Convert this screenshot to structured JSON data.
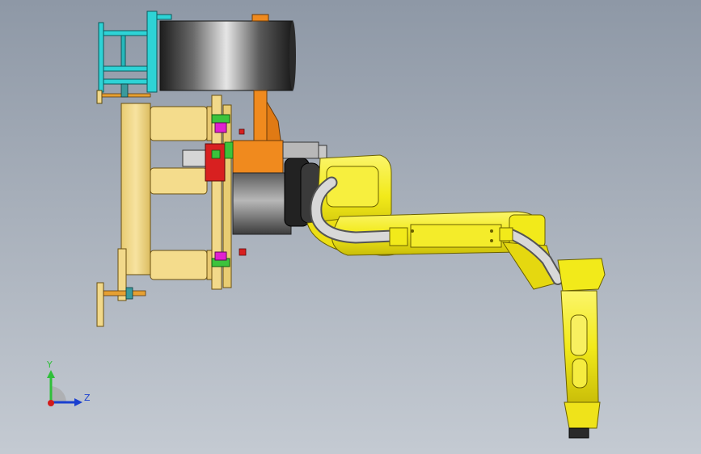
{
  "triad": {
    "y_label": "Y",
    "z_label": "Z",
    "y_color": "#2fbf3a",
    "z_color": "#1a3fd0",
    "x_color": "#d21b1b"
  },
  "colors": {
    "robot_yellow": "#f2ea1a",
    "fixture_tan": "#f2d98a",
    "bracket_cyan": "#2ed3d6",
    "orange_frame": "#f08a1e",
    "red_block": "#d82020",
    "green_clamp": "#3cc33c",
    "magenta_pin": "#e020d0"
  }
}
